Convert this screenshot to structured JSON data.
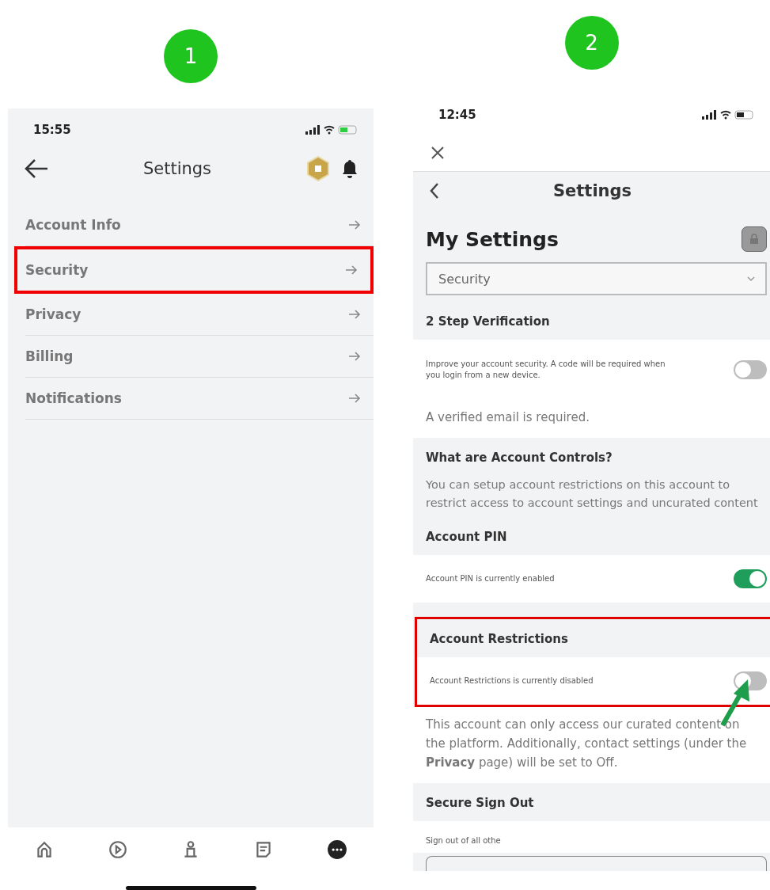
{
  "left_phone": {
    "step_badge": "1",
    "status_time": "15:55",
    "title": "Settings",
    "menu": [
      {
        "label": "Account Info",
        "highlighted": false
      },
      {
        "label": "Security",
        "highlighted": true
      },
      {
        "label": "Privacy",
        "highlighted": false
      },
      {
        "label": "Billing",
        "highlighted": false
      },
      {
        "label": "Notifications",
        "highlighted": false
      }
    ],
    "nav": [
      {
        "kind": "home",
        "selected": false
      },
      {
        "kind": "play",
        "selected": false
      },
      {
        "kind": "avatar",
        "selected": false
      },
      {
        "kind": "chat",
        "selected": false
      },
      {
        "kind": "more",
        "selected": true
      }
    ]
  },
  "right_phone": {
    "step_badge": "2",
    "status_time": "12:45",
    "title": "Settings",
    "page_title": "My Settings",
    "dropdown": {
      "value": "Security"
    },
    "sections": [
      {
        "kind": "heading",
        "text": "2 Step Verification"
      },
      {
        "kind": "toggle_row",
        "text": "Improve your account security. A code will be required when you login from a new device.",
        "on": false,
        "pointed": false
      },
      {
        "kind": "note",
        "text": "A verified email is required."
      },
      {
        "kind": "heading",
        "text": "What are Account Controls?"
      },
      {
        "kind": "info",
        "text": "You can setup account restrictions on this account to restrict access to account settings and uncurated content"
      },
      {
        "kind": "heading",
        "text": "Account PIN"
      },
      {
        "kind": "toggle_row",
        "text": "Account PIN is currently enabled",
        "on": true,
        "pointed": false
      },
      {
        "kind": "group",
        "highlighted": true,
        "items": [
          {
            "kind": "heading",
            "text": "Account Restrictions"
          },
          {
            "kind": "toggle_row",
            "text": "Account Restrictions is currently disabled",
            "on": false,
            "pointed": true
          }
        ]
      },
      {
        "kind": "note",
        "text": "This account can only access our curated content on the platform. Additionally, contact settings (under the **Privacy** page) will be set to Off."
      },
      {
        "kind": "heading",
        "text": "Secure Sign Out"
      },
      {
        "kind": "field_row",
        "text": "Sign out of all othe"
      }
    ]
  }
}
